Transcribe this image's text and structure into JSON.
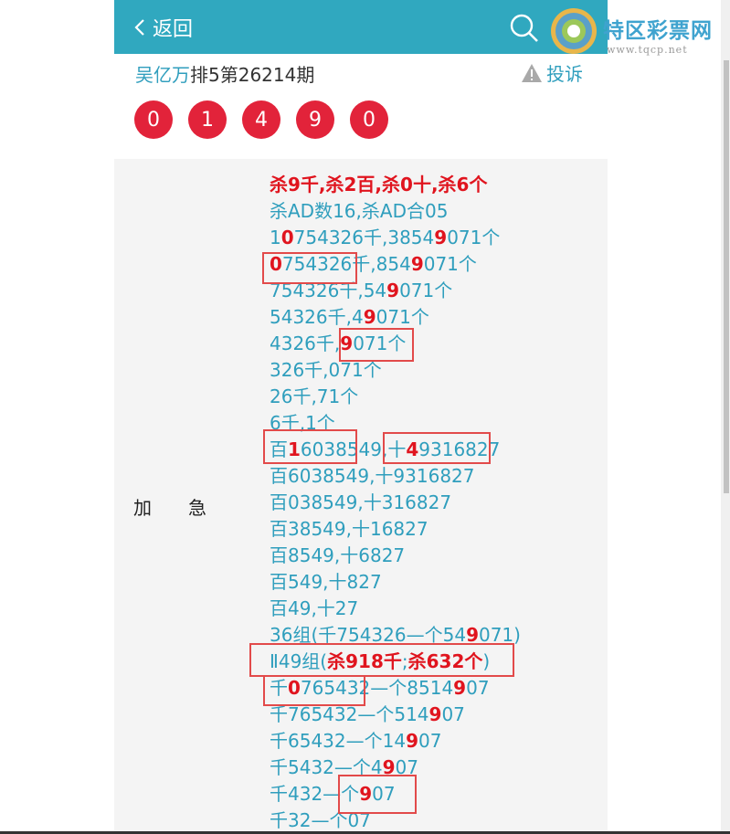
{
  "header": {
    "back_label": "返回"
  },
  "brand": {
    "name": "特区彩票网",
    "url": "www.tqcp.net"
  },
  "post": {
    "author": "吴亿万",
    "title": "排5第26214期",
    "report_label": "投诉"
  },
  "draw_numbers": [
    "0",
    "1",
    "4",
    "9",
    "0"
  ],
  "section_label": "加　　急",
  "lines": [
    [
      {
        "t": "杀9千,杀2百,杀0十,杀6个",
        "red": true
      }
    ],
    [
      {
        "t": "杀AD数16,杀AD合05"
      }
    ],
    [
      {
        "t": "1"
      },
      {
        "t": "0",
        "red": true
      },
      {
        "t": "754326千,3854"
      },
      {
        "t": "9",
        "red": true
      },
      {
        "t": "071个"
      }
    ],
    [
      {
        "t": "0",
        "red": true
      },
      {
        "t": "754326千,854"
      },
      {
        "t": "9",
        "red": true
      },
      {
        "t": "071个"
      }
    ],
    [
      {
        "t": "754326千,54"
      },
      {
        "t": "9",
        "red": true
      },
      {
        "t": "071个"
      }
    ],
    [
      {
        "t": "54326千,4"
      },
      {
        "t": "9",
        "red": true
      },
      {
        "t": "071个"
      }
    ],
    [
      {
        "t": "4326千,"
      },
      {
        "t": "9",
        "red": true
      },
      {
        "t": "071个"
      }
    ],
    [
      {
        "t": "326千,071个"
      }
    ],
    [
      {
        "t": "26千,71个"
      }
    ],
    [
      {
        "t": "6千,1个"
      }
    ],
    [
      {
        "t": "百"
      },
      {
        "t": "1",
        "red": true
      },
      {
        "t": "6038549,十"
      },
      {
        "t": "4",
        "red": true
      },
      {
        "t": "9316827"
      }
    ],
    [
      {
        "t": "百6038549,十9316827"
      }
    ],
    [
      {
        "t": "百038549,十316827"
      }
    ],
    [
      {
        "t": "百38549,十16827"
      }
    ],
    [
      {
        "t": "百8549,十6827"
      }
    ],
    [
      {
        "t": "百549,十827"
      }
    ],
    [
      {
        "t": "百49,十27"
      }
    ],
    [
      {
        "t": "36组(千754326—个54"
      },
      {
        "t": "9",
        "red": true
      },
      {
        "t": "071)"
      }
    ],
    [
      {
        "t": "Ⅱ49组("
      },
      {
        "t": "杀918千",
        "red": true
      },
      {
        "t": ";"
      },
      {
        "t": "杀632个",
        "red": true
      },
      {
        "t": ")"
      }
    ],
    [
      {
        "t": "千"
      },
      {
        "t": "0",
        "red": true
      },
      {
        "t": "765432—个8514"
      },
      {
        "t": "9",
        "red": true
      },
      {
        "t": "07"
      }
    ],
    [
      {
        "t": "千765432—个514"
      },
      {
        "t": "9",
        "red": true
      },
      {
        "t": "07"
      }
    ],
    [
      {
        "t": "千65432—个14"
      },
      {
        "t": "9",
        "red": true
      },
      {
        "t": "07"
      }
    ],
    [
      {
        "t": "千5432—个4"
      },
      {
        "t": "9",
        "red": true
      },
      {
        "t": "07"
      }
    ],
    [
      {
        "t": "千432—个"
      },
      {
        "t": "9",
        "red": true
      },
      {
        "t": "07"
      }
    ],
    [
      {
        "t": "千32—个07"
      }
    ]
  ]
}
